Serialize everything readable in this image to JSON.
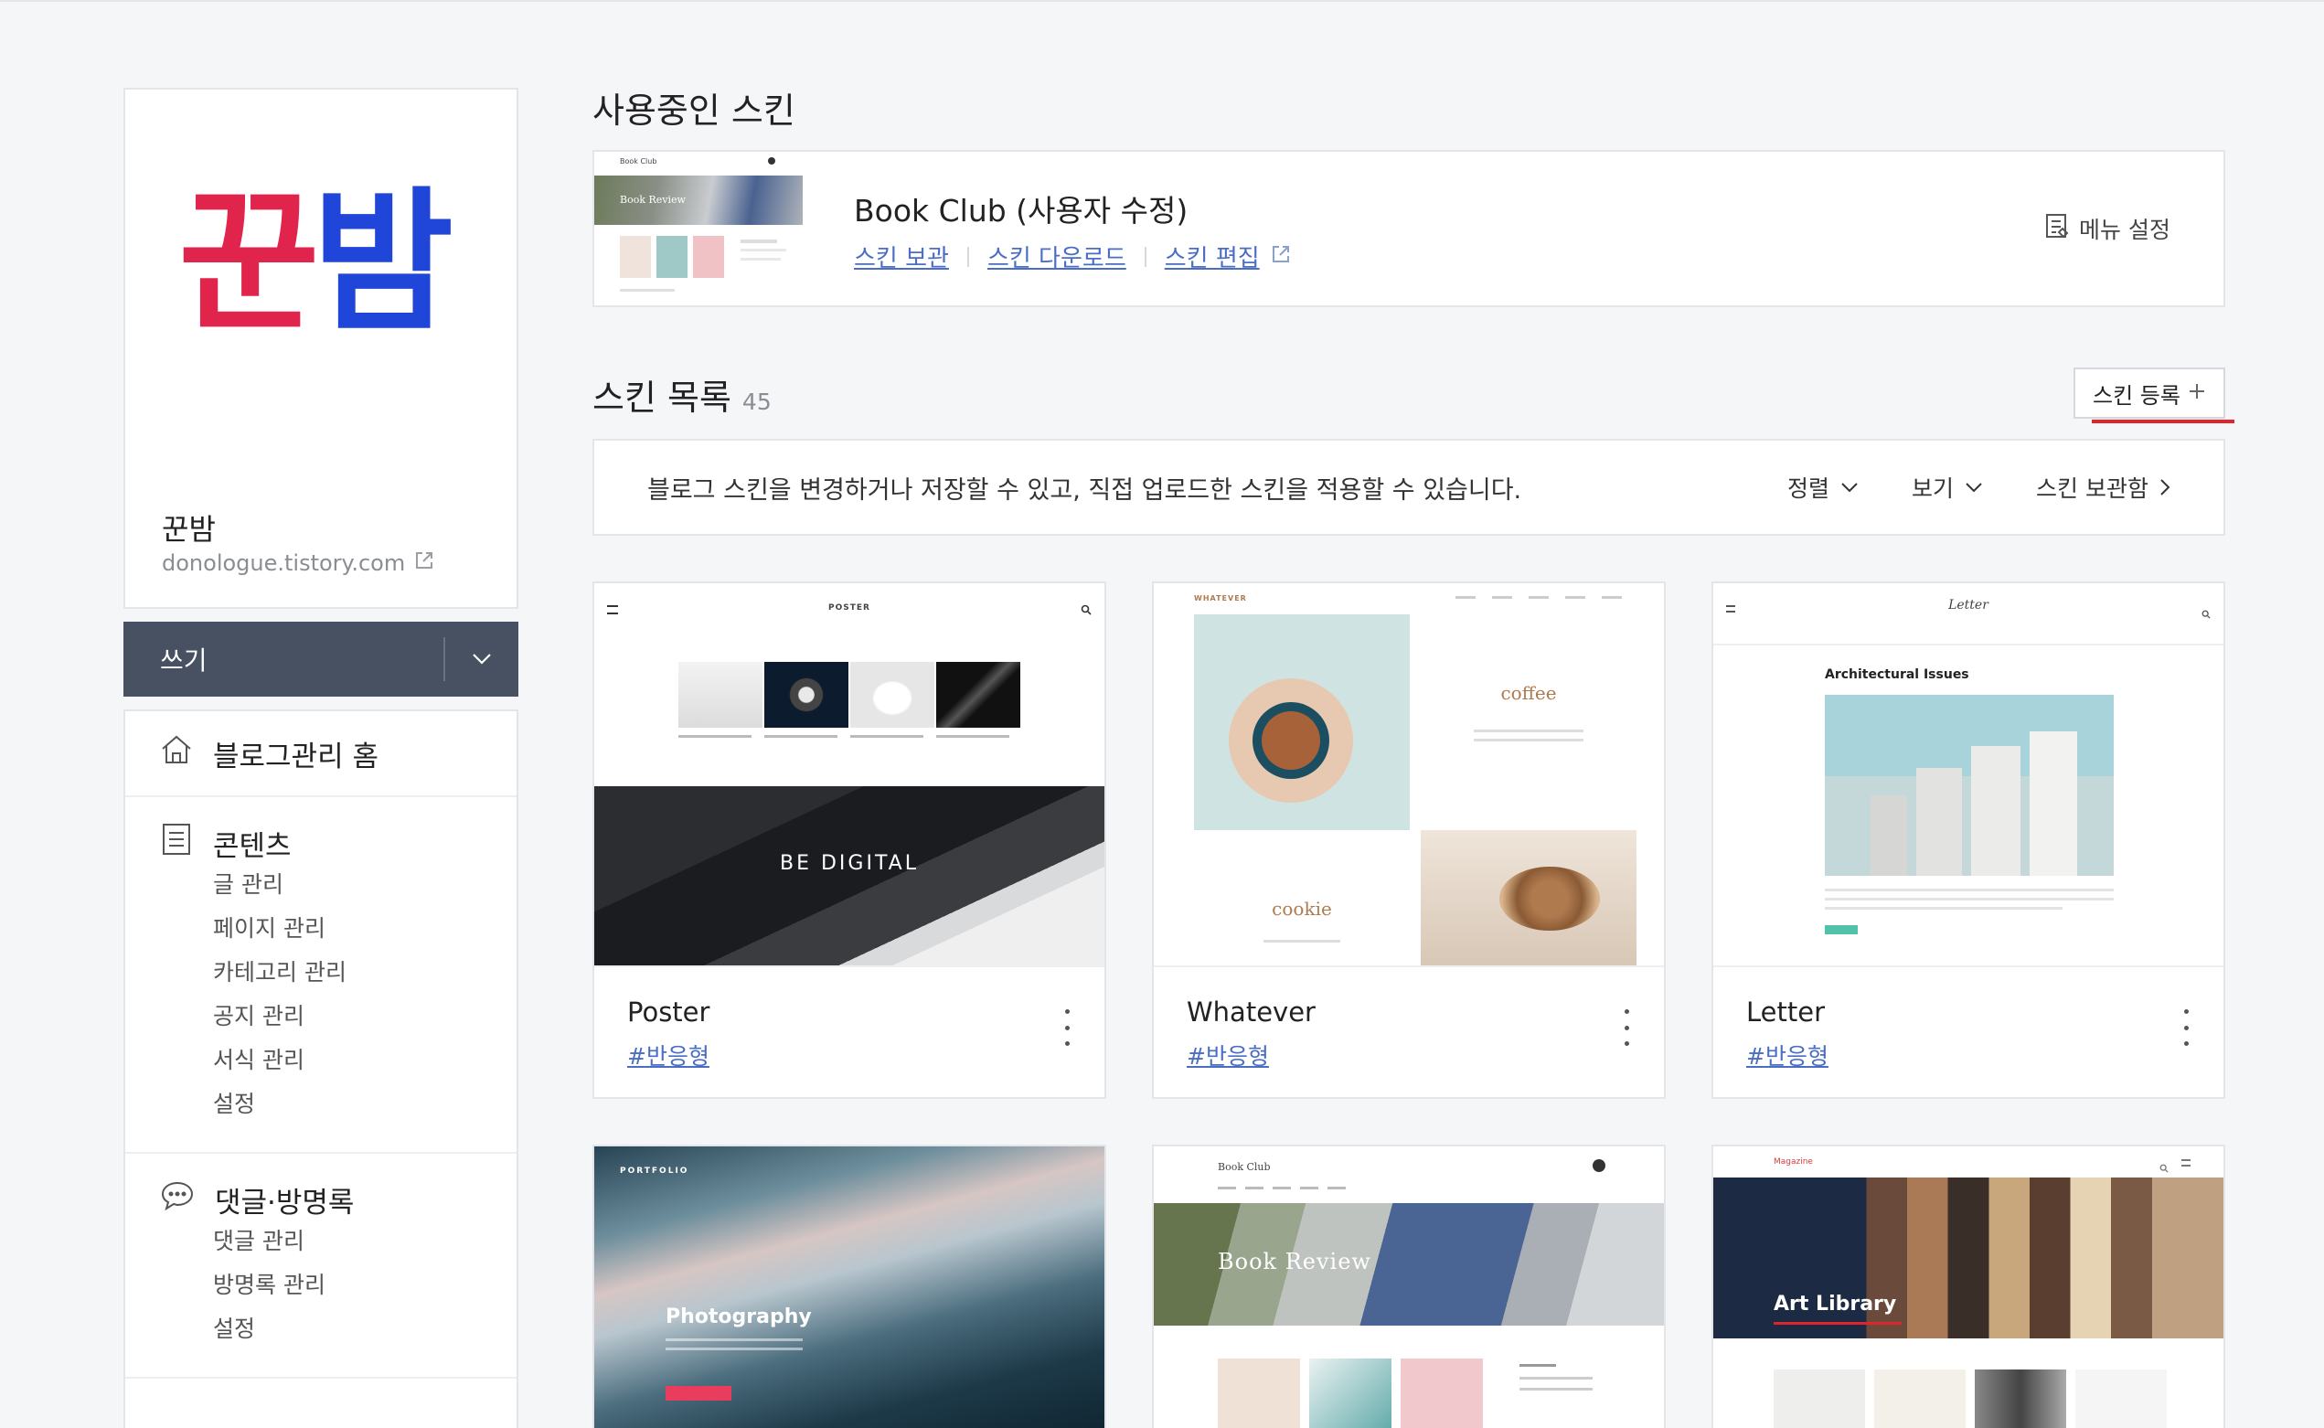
{
  "blog": {
    "logo_part1": "꾼",
    "logo_part2": "밤",
    "name": "꾼밤",
    "url": "donologue.tistory.com"
  },
  "write": {
    "label": "쓰기"
  },
  "nav": {
    "home": "블로그관리 홈",
    "contents": {
      "title": "콘텐츠",
      "items": [
        "글 관리",
        "페이지 관리",
        "카테고리 관리",
        "공지 관리",
        "서식 관리",
        "설정"
      ]
    },
    "comments": {
      "title": "댓글·방명록",
      "items": [
        "댓글 관리",
        "방명록 관리",
        "설정"
      ]
    }
  },
  "current_skin": {
    "heading": "사용중인 스킨",
    "name": "Book Club (사용자 수정)",
    "links": [
      "스킨 보관",
      "스킨 다운로드",
      "스킨 편집"
    ],
    "menu_setting": "메뉴 설정",
    "thumb_text": "Book Review",
    "thumb_brand": "Book Club"
  },
  "skin_list": {
    "heading": "스킨 목록",
    "count": "45",
    "register_button": "스킨 등록",
    "info": "블로그 스킨을 변경하거나 저장할 수 있고, 직접 업로드한 스킨을 적용할 수 있습니다.",
    "sort": "정렬",
    "view": "보기",
    "storage": "스킨 보관함"
  },
  "skins": [
    {
      "name": "Poster",
      "tag": "#반응형",
      "preview_brand": "POSTER",
      "preview_banner": "BE DIGITAL"
    },
    {
      "name": "Whatever",
      "tag": "#반응형",
      "preview_brand": "WHATEVER",
      "preview_word1": "coffee",
      "preview_word2": "cookie"
    },
    {
      "name": "Letter",
      "tag": "#반응형",
      "preview_brand": "Letter",
      "preview_headline": "Architectural Issues"
    },
    {
      "preview_brand": "PORTFOLIO",
      "preview_headline": "Photography"
    },
    {
      "preview_brand": "Book Club",
      "preview_headline": "Book Review"
    },
    {
      "preview_brand": "Magazine",
      "preview_headline": "Art Library"
    }
  ],
  "colors": {
    "accent_red": "#e0244c",
    "accent_blue": "#1f46d8",
    "link": "#4a6ec4",
    "write_bar": "#485162"
  }
}
